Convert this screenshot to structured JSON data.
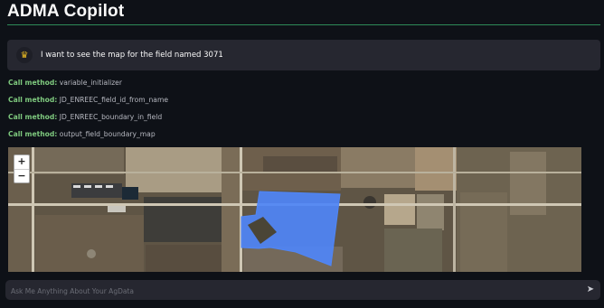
{
  "app": {
    "title": "ADMA Copilot"
  },
  "conversation": {
    "user_message": "I want to see the map for the field named 3071",
    "calls": [
      {
        "label": "Call method:",
        "method": "variable_initializer"
      },
      {
        "label": "Call method:",
        "method": "JD_ENREEC_field_id_from_name"
      },
      {
        "label": "Call method:",
        "method": "JD_ENREEC_boundary_in_field"
      },
      {
        "label": "Call method:",
        "method": "output_field_boundary_map"
      }
    ]
  },
  "map": {
    "zoom_in": "+",
    "zoom_out": "−",
    "boundary_color": "#4f86f7"
  },
  "chat": {
    "placeholder": "Ask Me Anything About Your AgData"
  },
  "colors": {
    "background": "#0e1117",
    "header_rule": "#2e8b57",
    "call_label": "#7ec97e"
  }
}
